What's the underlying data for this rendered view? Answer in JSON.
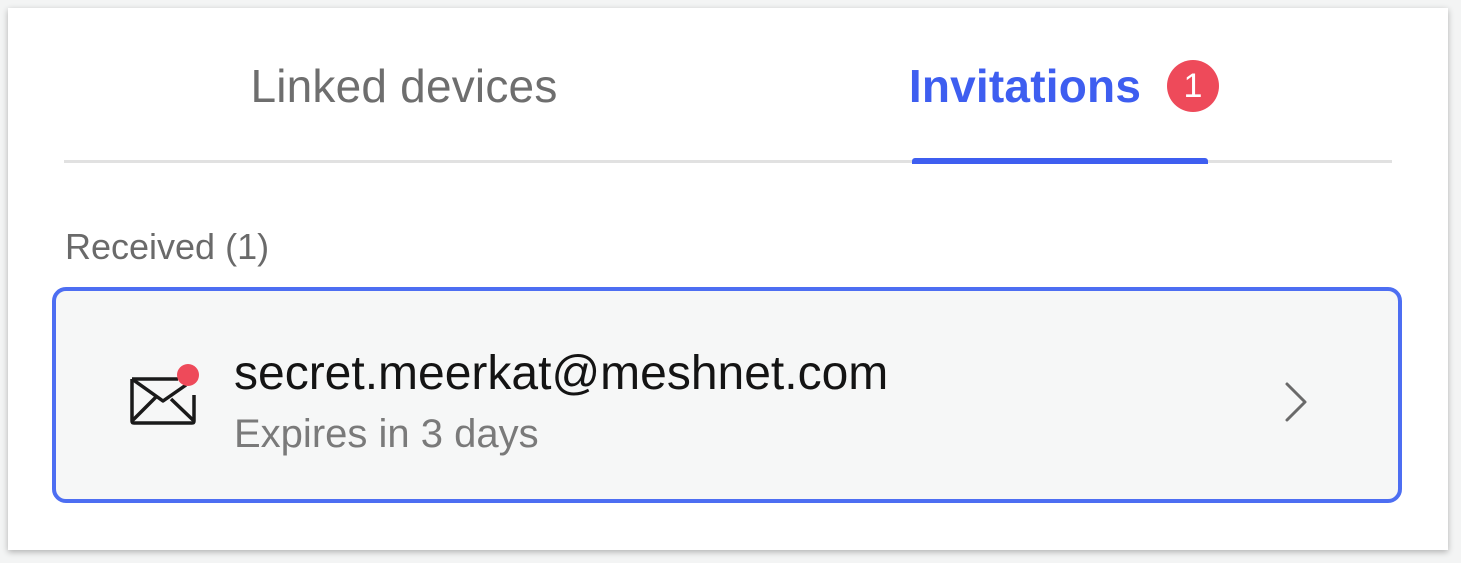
{
  "tabs": {
    "linked_devices": "Linked devices",
    "invitations": "Invitations",
    "invitations_badge": "1",
    "active": "invitations"
  },
  "received": {
    "section_label": "Received (1)",
    "items": [
      {
        "email": "secret.meerkat@meshnet.com",
        "expires": "Expires in 3 days",
        "icon": "envelope-unread-icon"
      }
    ]
  },
  "colors": {
    "accent": "#3e5ef0",
    "badge": "#ee4a5a",
    "row_border": "#4d6ef2"
  }
}
